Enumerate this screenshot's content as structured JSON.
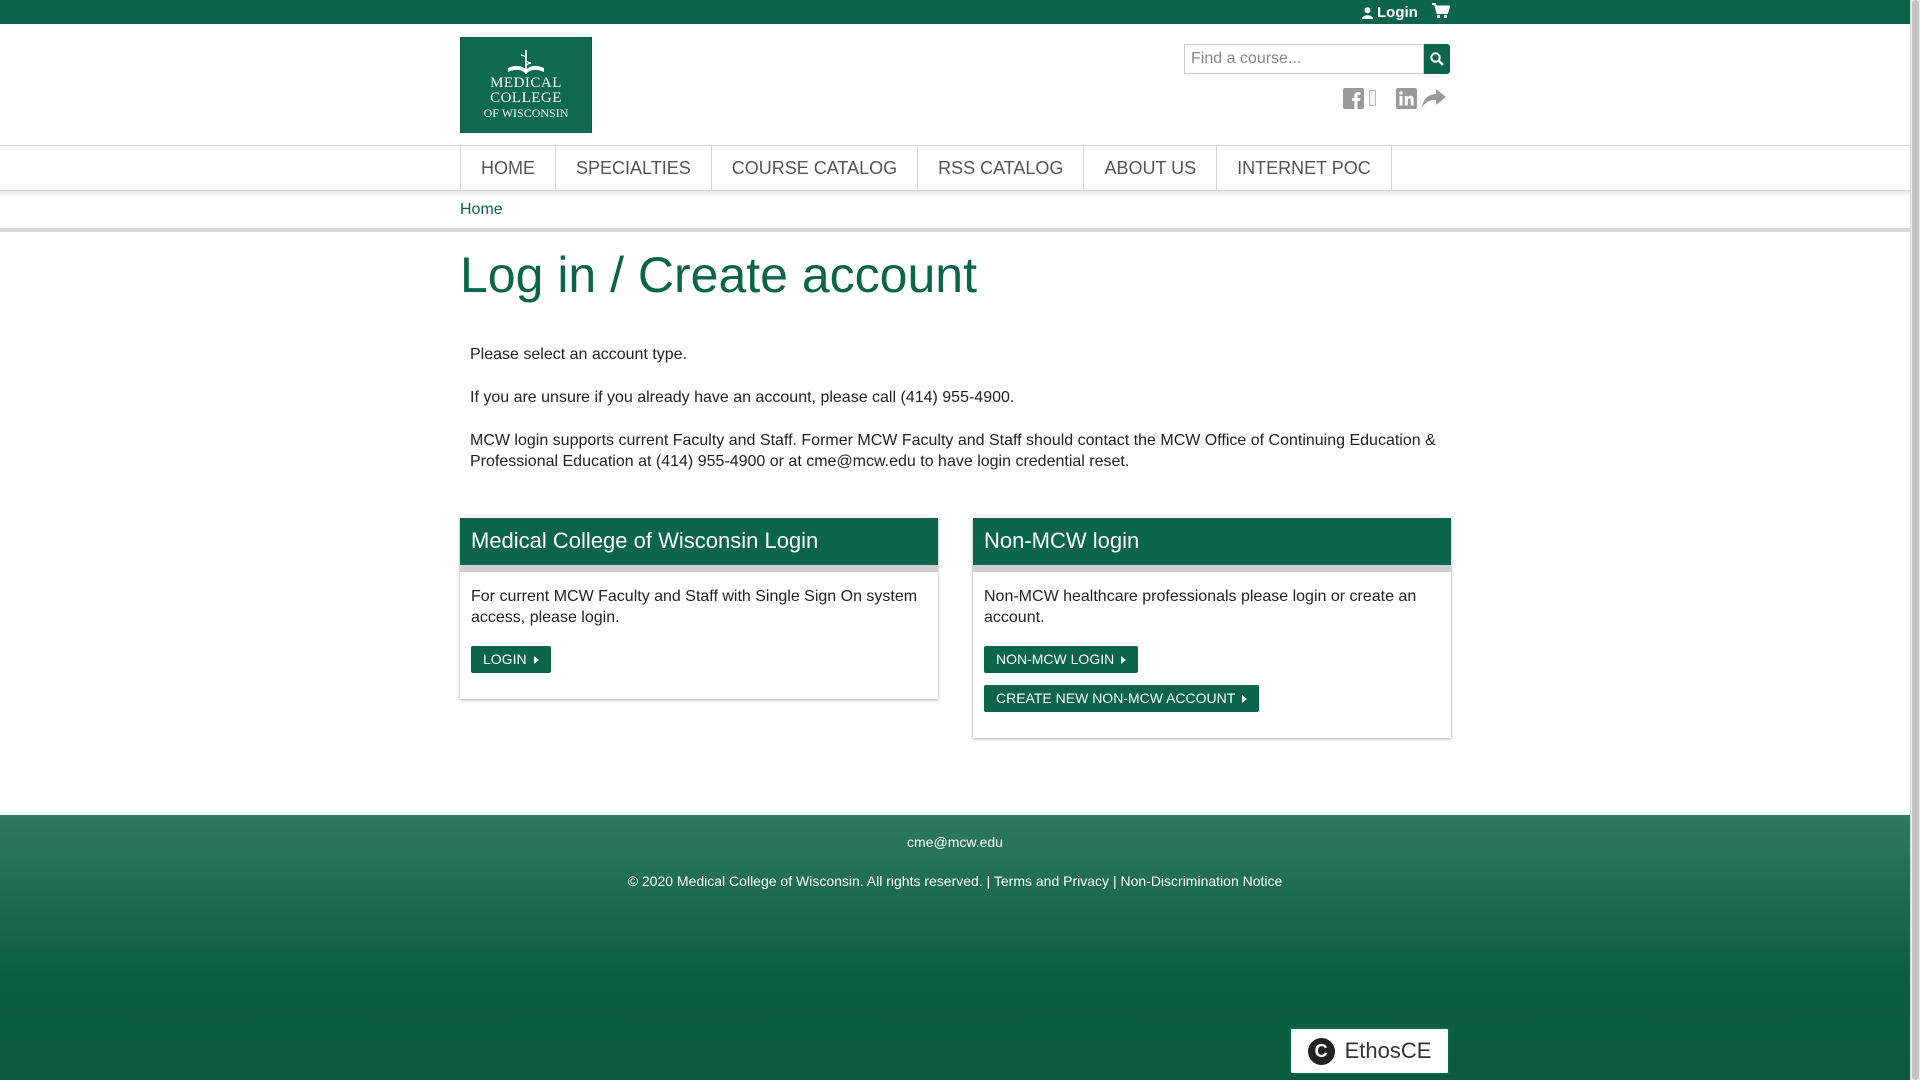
{
  "topbar": {
    "login_label": "Login",
    "cart_icon": "cart-icon",
    "user_icon": "user-icon"
  },
  "header": {
    "logo": {
      "line1": "MEDICAL",
      "line2": "COLLEGE",
      "line3": "OF WISCONSIN"
    },
    "search": {
      "placeholder": "Find a course...",
      "icon": "search-icon"
    },
    "social": [
      "facebook-icon",
      "linkedin-icon",
      "share-icon"
    ]
  },
  "nav": {
    "items": [
      "HOME",
      "SPECIALTIES",
      "COURSE CATALOG",
      "RSS CATALOG",
      "ABOUT US",
      "INTERNET POC"
    ]
  },
  "breadcrumb": {
    "home": "Home"
  },
  "main": {
    "title": "Log in / Create account",
    "intro": [
      "Please select an account type.",
      "If you are unsure if you already have an account, please call (414) 955-4900.",
      "MCW login supports current Faculty and Staff. Former MCW Faculty and Staff should contact the MCW Office of Continuing Education & Professional Education at (414) 955-4900 or at cme@mcw.edu to have login credential reset."
    ],
    "panels": [
      {
        "title": "Medical College of Wisconsin Login",
        "text": "For current MCW Faculty and Staff with Single Sign On system access, please login.",
        "buttons": [
          "LOGIN"
        ]
      },
      {
        "title": "Non-MCW login",
        "text": "Non-MCW healthcare professionals please login or create an account.",
        "buttons": [
          "NON-MCW LOGIN",
          "CREATE NEW NON-MCW ACCOUNT"
        ]
      }
    ]
  },
  "footer": {
    "email": "cme@mcw.edu",
    "copyright": "© 2020 Medical College of Wisconsin. All rights reserved.",
    "separator": "|",
    "terms": "Terms and Privacy",
    "nondisc": "Non-Discrimination Notice",
    "badge": {
      "letter": "C",
      "text": "EthosCE"
    }
  },
  "colors": {
    "brand": "#0b6548",
    "footer": "#0b5e41"
  }
}
